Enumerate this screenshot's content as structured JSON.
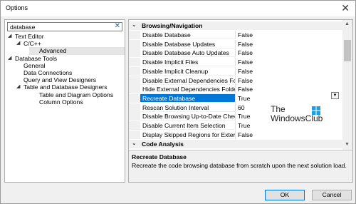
{
  "window": {
    "title": "Options"
  },
  "search": {
    "value": "database"
  },
  "tree": [
    {
      "label": "Text Editor",
      "level": 0,
      "expanded": true,
      "selected": false
    },
    {
      "label": "C/C++",
      "level": 1,
      "expanded": true,
      "selected": false
    },
    {
      "label": "Advanced",
      "level": 2,
      "expanded": null,
      "selected": true
    },
    {
      "label": "Database Tools",
      "level": 0,
      "expanded": true,
      "selected": false
    },
    {
      "label": "General",
      "level": 1,
      "expanded": null,
      "selected": false
    },
    {
      "label": "Data Connections",
      "level": 1,
      "expanded": null,
      "selected": false
    },
    {
      "label": "Query and View Designers",
      "level": 1,
      "expanded": null,
      "selected": false
    },
    {
      "label": "Table and Database Designers",
      "level": 1,
      "expanded": true,
      "selected": false
    },
    {
      "label": "Table and Diagram Options",
      "level": 2,
      "expanded": null,
      "selected": false
    },
    {
      "label": "Column Options",
      "level": 2,
      "expanded": null,
      "selected": false
    }
  ],
  "grid": {
    "category1": "Browsing/Navigation",
    "category2": "Code Analysis",
    "properties": [
      {
        "name": "Disable Database",
        "value": "False",
        "selected": false
      },
      {
        "name": "Disable Database Updates",
        "value": "False",
        "selected": false
      },
      {
        "name": "Disable Database Auto Updates",
        "value": "False",
        "selected": false
      },
      {
        "name": "Disable Implicit Files",
        "value": "False",
        "selected": false
      },
      {
        "name": "Disable Implicit Cleanup",
        "value": "False",
        "selected": false
      },
      {
        "name": "Disable External Dependencies Folders",
        "value": "False",
        "selected": false
      },
      {
        "name": "Hide External Dependencies Folders",
        "value": "False",
        "selected": false
      },
      {
        "name": "Recreate Database",
        "value": "True",
        "selected": true
      },
      {
        "name": "Rescan Solution Interval",
        "value": "60",
        "selected": false
      },
      {
        "name": "Disable Browsing Up-to-Date Check",
        "value": "True",
        "selected": false
      },
      {
        "name": "Disable Current Item Selection",
        "value": "True",
        "selected": false
      },
      {
        "name": "Display Skipped Regions for External",
        "value": "False",
        "selected": false
      }
    ]
  },
  "description": {
    "title": "Recreate Database",
    "text": "Recreate the code browsing database from scratch upon the next solution load."
  },
  "watermark": {
    "line1": "The",
    "line2": "WindowsClub"
  },
  "buttons": {
    "ok": "OK",
    "cancel": "Cancel"
  },
  "colors": {
    "selection": "#0078d7",
    "background": "#f0f0f0"
  }
}
